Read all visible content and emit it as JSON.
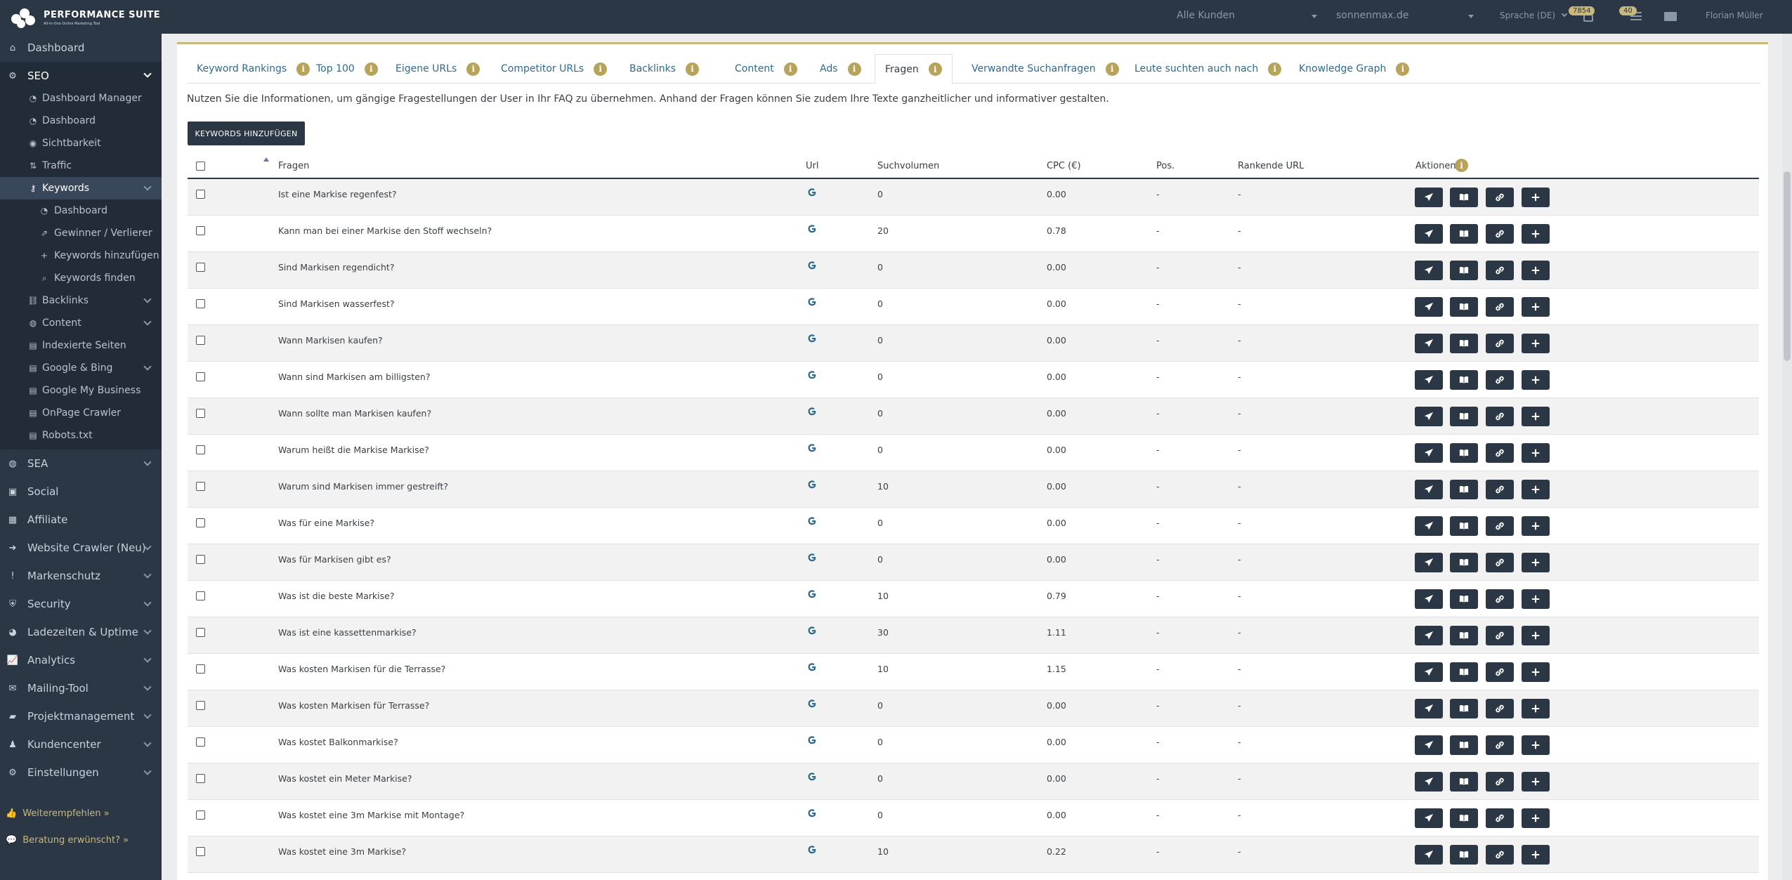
{
  "app": {
    "logo_title": "PERFORMANCE SUITE",
    "logo_subtitle": "All-In-One Online Marketing Tool"
  },
  "topbar": {
    "customer_select": "Alle Kunden",
    "domain_select": "sonnenmax.de",
    "language": "Sprache (DE)",
    "notification_count": "7854",
    "list_count": "40",
    "user_name": "Florian Müller"
  },
  "sidebar": {
    "items": [
      {
        "label": "Dashboard",
        "icon": "home-icon"
      },
      {
        "label": "SEO",
        "icon": "seo-icon"
      },
      {
        "label": "SEA",
        "icon": "globe-icon"
      },
      {
        "label": "Social",
        "icon": "social-icon"
      },
      {
        "label": "Affiliate",
        "icon": "affiliate-icon"
      },
      {
        "label": "Website Crawler (Neu)",
        "icon": "arrow-icon"
      },
      {
        "label": "Markenschutz",
        "icon": "exclamation-icon"
      },
      {
        "label": "Security",
        "icon": "shield-icon"
      },
      {
        "label": "Ladezeiten & Uptime",
        "icon": "speed-icon"
      },
      {
        "label": "Analytics",
        "icon": "chart-icon"
      },
      {
        "label": "Mailing-Tool",
        "icon": "mail-icon"
      },
      {
        "label": "Projektmanagement",
        "icon": "briefcase-icon"
      },
      {
        "label": "Kundencenter",
        "icon": "users-icon"
      },
      {
        "label": "Einstellungen",
        "icon": "settings-icon"
      }
    ],
    "seo_sub": [
      {
        "label": "Dashboard Manager"
      },
      {
        "label": "Dashboard"
      },
      {
        "label": "Sichtbarkeit"
      },
      {
        "label": "Traffic"
      },
      {
        "label": "Keywords"
      },
      {
        "label": "Dashboard"
      },
      {
        "label": "Gewinner / Verlierer"
      },
      {
        "label": "Keywords hinzufügen"
      },
      {
        "label": "Keywords finden"
      },
      {
        "label": "Backlinks"
      },
      {
        "label": "Content"
      },
      {
        "label": "Indexierte Seiten"
      },
      {
        "label": "Google & Bing"
      },
      {
        "label": "Google My Business"
      },
      {
        "label": "OnPage Crawler"
      },
      {
        "label": "Robots.txt"
      }
    ],
    "footer_recommend": "Weiterempfehlen »",
    "footer_consult": "Beratung erwünscht? »"
  },
  "tabs": [
    {
      "label": "Keyword Rankings"
    },
    {
      "label": "Top 100"
    },
    {
      "label": "Eigene URLs"
    },
    {
      "label": "Competitor URLs"
    },
    {
      "label": "Backlinks"
    },
    {
      "label": "Content"
    },
    {
      "label": "Ads"
    },
    {
      "label": "Fragen"
    },
    {
      "label": "Verwandte Suchanfragen"
    },
    {
      "label": "Leute suchten auch nach"
    },
    {
      "label": "Knowledge Graph"
    }
  ],
  "active_tab": "Fragen",
  "description": "Nutzen Sie die Informationen, um gängige Fragestellungen der User in Ihr FAQ zu übernehmen. Anhand der Fragen können Sie zudem Ihre Texte ganzheitlicher und informativer gestalten.",
  "add_keywords_button": "KEYWORDS HINZUFÜGEN",
  "table": {
    "columns": {
      "question": "Fragen",
      "url": "Url",
      "volume": "Suchvolumen",
      "cpc": "CPC (€)",
      "pos": "Pos.",
      "ranking_url": "Rankende URL",
      "actions": "Aktionen"
    },
    "rows": [
      {
        "q": "Ist eine Markise regenfest?",
        "vol": "0",
        "cpc": "0.00",
        "pos": "-",
        "rurl": "-"
      },
      {
        "q": "Kann man bei einer Markise den Stoff wechseln?",
        "vol": "20",
        "cpc": "0.78",
        "pos": "-",
        "rurl": "-"
      },
      {
        "q": "Sind Markisen regendicht?",
        "vol": "0",
        "cpc": "0.00",
        "pos": "-",
        "rurl": "-"
      },
      {
        "q": "Sind Markisen wasserfest?",
        "vol": "0",
        "cpc": "0.00",
        "pos": "-",
        "rurl": "-"
      },
      {
        "q": "Wann Markisen kaufen?",
        "vol": "0",
        "cpc": "0.00",
        "pos": "-",
        "rurl": "-"
      },
      {
        "q": "Wann sind Markisen am billigsten?",
        "vol": "0",
        "cpc": "0.00",
        "pos": "-",
        "rurl": "-"
      },
      {
        "q": "Wann sollte man Markisen kaufen?",
        "vol": "0",
        "cpc": "0.00",
        "pos": "-",
        "rurl": "-"
      },
      {
        "q": "Warum heißt die Markise Markise?",
        "vol": "0",
        "cpc": "0.00",
        "pos": "-",
        "rurl": "-"
      },
      {
        "q": "Warum sind Markisen immer gestreift?",
        "vol": "10",
        "cpc": "0.00",
        "pos": "-",
        "rurl": "-"
      },
      {
        "q": "Was für eine Markise?",
        "vol": "0",
        "cpc": "0.00",
        "pos": "-",
        "rurl": "-"
      },
      {
        "q": "Was für Markisen gibt es?",
        "vol": "0",
        "cpc": "0.00",
        "pos": "-",
        "rurl": "-"
      },
      {
        "q": "Was ist die beste Markise?",
        "vol": "10",
        "cpc": "0.79",
        "pos": "-",
        "rurl": "-"
      },
      {
        "q": "Was ist eine kassettenmarkise?",
        "vol": "30",
        "cpc": "1.11",
        "pos": "-",
        "rurl": "-"
      },
      {
        "q": "Was kosten Markisen für die Terrasse?",
        "vol": "10",
        "cpc": "1.15",
        "pos": "-",
        "rurl": "-"
      },
      {
        "q": "Was kosten Markisen für Terrasse?",
        "vol": "0",
        "cpc": "0.00",
        "pos": "-",
        "rurl": "-"
      },
      {
        "q": "Was kostet Balkonmarkise?",
        "vol": "0",
        "cpc": "0.00",
        "pos": "-",
        "rurl": "-"
      },
      {
        "q": "Was kostet ein Meter Markise?",
        "vol": "0",
        "cpc": "0.00",
        "pos": "-",
        "rurl": "-"
      },
      {
        "q": "Was kostet eine 3m Markise mit Montage?",
        "vol": "0",
        "cpc": "0.00",
        "pos": "-",
        "rurl": "-"
      },
      {
        "q": "Was kostet eine 3m Markise?",
        "vol": "10",
        "cpc": "0.22",
        "pos": "-",
        "rurl": "-"
      }
    ]
  },
  "colors": {
    "sidebar_bg": "#2b3745",
    "accent_gold": "#c8b87a",
    "link_blue": "#2e6a8e"
  }
}
